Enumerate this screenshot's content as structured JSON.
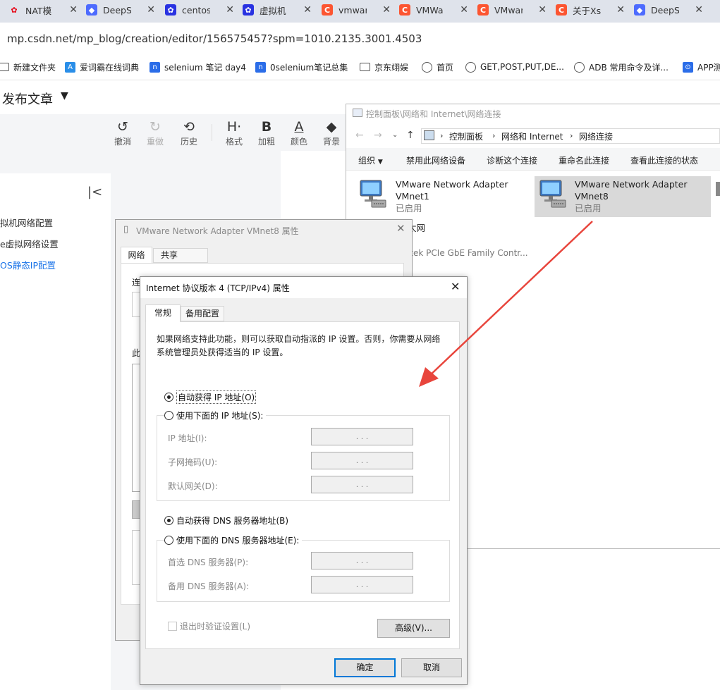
{
  "browser": {
    "tabs": [
      {
        "title": "NAT模",
        "icon": "huawei-icon",
        "color": "#e60012"
      },
      {
        "title": "DeepS",
        "icon": "deepseek-icon",
        "color": "#4d6bfe"
      },
      {
        "title": "centos",
        "icon": "paw-icon",
        "color": "#2932e1"
      },
      {
        "title": "虚拟机",
        "icon": "paw-icon",
        "color": "#2932e1"
      },
      {
        "title": "vmwar",
        "icon": "csdn-icon",
        "color": "#fc5531"
      },
      {
        "title": "VMWa",
        "icon": "csdn-icon",
        "color": "#fc5531"
      },
      {
        "title": "VMwar",
        "icon": "csdn-icon",
        "color": "#fc5531"
      },
      {
        "title": "关于Xsl",
        "icon": "csdn-icon",
        "color": "#fc5531"
      },
      {
        "title": "DeepS",
        "icon": "deepseek-icon",
        "color": "#4d6bfe"
      }
    ],
    "url": "mp.csdn.net/mp_blog/creation/editor/156575457?spm=1010.2135.3001.4503",
    "bookmarks": [
      {
        "label": "新建文件夹",
        "icon": "folder-icon"
      },
      {
        "label": "爱词霸在线词典",
        "icon": "iciba-icon"
      },
      {
        "label": "selenium 笔记 day4",
        "icon": "jianshu-icon"
      },
      {
        "label": "0selenium笔记总集",
        "icon": "jianshu-icon"
      },
      {
        "label": "京东翊娱",
        "icon": "folder-icon"
      },
      {
        "label": "首页",
        "icon": "globe-icon"
      },
      {
        "label": "GET,POST,PUT,DE...",
        "icon": "globe-icon"
      },
      {
        "label": "ADB 常用命令及详...",
        "icon": "globe-icon"
      },
      {
        "label": "APP测",
        "icon": "app-icon"
      }
    ]
  },
  "editor": {
    "publish_title": "发布文章",
    "toolbar": {
      "undo": "撤消",
      "redo": "重做",
      "history": "历史",
      "format": "格式",
      "bold": "加粗",
      "color": "颜色",
      "background": "背景"
    },
    "left_items": [
      "拟机网络配置",
      "e虚拟网络设置",
      "OS静态IP配置"
    ]
  },
  "explorer": {
    "title": "控制面板\\网络和 Internet\\网络连接",
    "breadcrumb": [
      "控制面板",
      "网络和 Internet",
      "网络连接"
    ],
    "commands": [
      "组织",
      "禁用此网络设备",
      "诊断这个连接",
      "重命名此连接",
      "查看此连接的状态"
    ],
    "items": [
      {
        "name": "VMware Network Adapter",
        "sub": "VMnet1",
        "status": "已启用"
      },
      {
        "name": "VMware Network Adapter",
        "sub": "VMnet8",
        "status": "已启用"
      }
    ],
    "partial_item": {
      "name": "太网",
      "sub": "ltek PCIe GbE Family Contr..."
    }
  },
  "dialog1": {
    "title": "VMware Network Adapter VMnet8 属性",
    "tabs": [
      "网络",
      "共享"
    ],
    "partial_labels": [
      "连",
      "此"
    ]
  },
  "dialog2": {
    "title": "Internet 协议版本 4 (TCP/IPv4) 属性",
    "tabs": [
      "常规",
      "备用配置"
    ],
    "description": "如果网络支持此功能，则可以获取自动指派的 IP 设置。否则，你需要从网络系统管理员处获得适当的 IP 设置。",
    "auto_ip": "自动获得 IP 地址(O)",
    "manual_ip": "使用下面的 IP 地址(S):",
    "ip_label": "IP 地址(I):",
    "mask_label": "子网掩码(U):",
    "gateway_label": "默认网关(D):",
    "auto_dns": "自动获得 DNS 服务器地址(B)",
    "manual_dns": "使用下面的 DNS 服务器地址(E):",
    "dns1_label": "首选 DNS 服务器(P):",
    "dns2_label": "备用 DNS 服务器(A):",
    "validate": "退出时验证设置(L)",
    "advanced": "高级(V)...",
    "ok": "确定",
    "cancel": "取消",
    "ip_dots": ".   .   ."
  },
  "annotation_color": "#e8453c"
}
